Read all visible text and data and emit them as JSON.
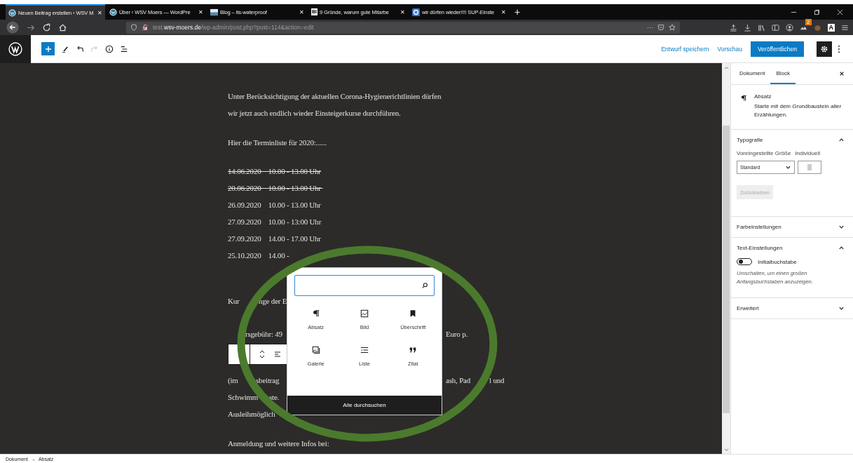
{
  "browser": {
    "tabs": [
      {
        "title": "Neuen Beitrag erstellen ‹ WSV M",
        "close": "✕",
        "selected": true
      },
      {
        "title": "Über ‹ WSV Moers — WordPre",
        "close": "✕",
        "selected": false
      },
      {
        "title": "Blog – its-waterproof",
        "close": "✕",
        "selected": false
      },
      {
        "title": "9 Gründe, warum gute Mitarbe",
        "icon_text": "BI",
        "close": "✕",
        "selected": false
      },
      {
        "title": "wir dürfen wieder!!!! SUP-Einste",
        "close": "✕",
        "selected": false
      }
    ],
    "new_tab": "+",
    "url": [
      {
        "text": "test.",
        "kind": "dim"
      },
      {
        "text": "wsv-moers.de",
        "kind": "host"
      },
      {
        "text": "/wp-admin/post.php?post=114&action=edit",
        "kind": "dim"
      }
    ],
    "url_more": "···",
    "badge": "2",
    "extension_letter": "A"
  },
  "header": {
    "actions": [
      {
        "label": "Entwurf speichern",
        "kind": "link"
      },
      {
        "label": "Vorschau",
        "kind": "link"
      },
      {
        "label": "Veröffentlichen",
        "kind": "primary"
      }
    ],
    "settings_active": true,
    "redo_disabled": true
  },
  "content": {
    "paragraphs": [
      {
        "lines": [
          {
            "struck": false,
            "fragments": [
              "Unter Berücksichtigung der aktuellen Corona-Hygienerichtlinien dürfen"
            ]
          },
          {
            "struck": false,
            "fragments": [
              "wir jetzt auch endlich wieder Einsteigerkurse durchführen."
            ]
          }
        ]
      },
      {
        "lines": [
          {
            "struck": false,
            "fragments": [
              "Hier die Terminliste für 2020:......"
            ]
          }
        ]
      },
      {
        "lines": [
          {
            "struck": true,
            "fragments": [
              "14.06.2020    10.00 - 13.00 Uhr"
            ]
          },
          {
            "struck": true,
            "fragments": [
              "20.06.2020    10.00 - 13.00 Uhr "
            ]
          },
          {
            "struck": false,
            "fragments": [
              "26.09.2020    10.00 - 13.00 Uhr"
            ]
          },
          {
            "struck": false,
            "fragments": [
              "27.09.2020    10.00 - 13:00 Uhr"
            ]
          },
          {
            "struck": false,
            "fragments": [
              "27.09.2020    14.00 - 17.00 Uhr"
            ]
          },
          {
            "struck": false,
            "fragments": [
              "25.10.2020    14.00 -"
            ]
          }
        ]
      },
      {
        "lines": [
          {
            "struck": false,
            "fragments": [
              "Kur",
              "nge der E"
            ]
          }
        ]
      },
      {
        "lines": [
          {
            "struck": false,
            "fragments": [
              "rsgebühr: 49",
              "Euro p."
            ]
          }
        ]
      },
      {
        "selected": true,
        "lines": [
          {
            "struck": false,
            "fragments": [
              "(im",
              "sbeitrag",
              "ash, Pad",
              "l und"
            ]
          },
          {
            "struck": false,
            "fragments": [
              "Schwimm",
              "ste."
            ]
          },
          {
            "struck": false,
            "fragments": [
              "Ausleihmöglich"
            ]
          }
        ]
      },
      {
        "lines": [
          {
            "struck": false,
            "fragments": [
              "Anmeldung und weitere Infos bei:"
            ]
          }
        ]
      }
    ]
  },
  "inserter": {
    "items": [
      {
        "label": "Absatz",
        "kind": "paragraph"
      },
      {
        "label": "Bild",
        "kind": "image"
      },
      {
        "label": "Überschrift",
        "kind": "heading"
      },
      {
        "label": "Galerie",
        "kind": "gallery"
      },
      {
        "label": "Liste",
        "kind": "list"
      },
      {
        "label": "Zitat",
        "kind": "quote"
      }
    ],
    "footer": "Alle durchsuchen"
  },
  "sidebar": {
    "tabs": [
      {
        "label": "Dokument",
        "selected": false
      },
      {
        "label": "Block",
        "selected": true
      }
    ],
    "block": {
      "title": "Absatz",
      "description": "Starte mit dem Grundbaustein aller Erzählungen."
    },
    "panels": [
      {
        "title": "Typografie",
        "expanded": true,
        "kind": "typography",
        "size_label": "Voreingestellte Größe",
        "custom_label": "Individuell",
        "size_value": "Standard",
        "reset": "Zurücksetzen",
        "reset_disabled": true
      },
      {
        "title": "Farbeinstellungen",
        "expanded": false
      },
      {
        "title": "Text-Einstellungen",
        "expanded": true,
        "kind": "text",
        "toggle_label": "Initialbuchstabe",
        "toggle_on": false,
        "help": "Umschalten, um einen großen Anfangsbuchstaben anzuzeigen."
      },
      {
        "title": "Erweitert",
        "expanded": false
      }
    ]
  },
  "breadcrumb": [
    "Dokument",
    "→",
    "Absatz"
  ]
}
